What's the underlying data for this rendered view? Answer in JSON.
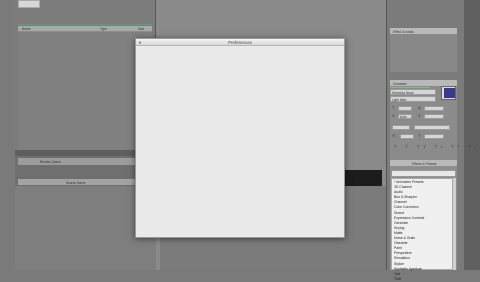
{
  "dialog": {
    "title": "Preferences"
  },
  "project_panel": {
    "column_name": "Name",
    "column_type": "Type",
    "column_size": "Size"
  },
  "timeline": {
    "tab_label": "Render Queue",
    "search_label": "Source Name"
  },
  "info_panel": {
    "tab_label": "Effect Controls"
  },
  "character_panel": {
    "tab_label": "Character",
    "font_name": "Helvetica Neue",
    "font_style": "Light Italic",
    "tracking_label": "Auto"
  },
  "effects_panel": {
    "tab_label": "Effects & Presets",
    "items": [
      "* Animation Presets",
      "3D Channel",
      "Audio",
      "Blur & Sharpen",
      "Channel",
      "Color Correction",
      "Distort",
      "Expression Controls",
      "Generate",
      "Keying",
      "Matte",
      "Noise & Grain",
      "Obsolete",
      "Paint",
      "Perspective",
      "Simulation",
      "Stylize",
      "Synthetic Aperture",
      "Text",
      "Time"
    ]
  },
  "colors": {
    "dialog_bg": "#ececec",
    "panel_bg": "#7b7b7b",
    "accent_green": "#4fa27a",
    "swatch_fill": "#3a3a8c"
  }
}
